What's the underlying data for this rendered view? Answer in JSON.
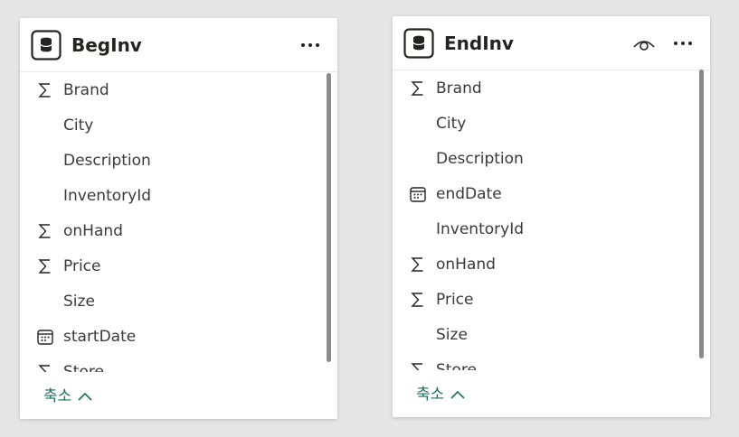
{
  "colors": {
    "background": "#e6e6e6",
    "card": "#ffffff",
    "title_text": "#252423",
    "field_text": "#3b3a39",
    "icon": "#252423",
    "collapse_link": "#1b6e5a",
    "scrollbar": "#8a8a8a"
  },
  "cards": [
    {
      "title": "BegInv",
      "header_icons": [
        "table-icon",
        "more-options-icon"
      ],
      "collapse_label": "축소",
      "fields": [
        {
          "label": "Brand",
          "icon": "sigma-icon"
        },
        {
          "label": "City",
          "icon": null
        },
        {
          "label": "Description",
          "icon": null
        },
        {
          "label": "InventoryId",
          "icon": null
        },
        {
          "label": "onHand",
          "icon": "sigma-icon"
        },
        {
          "label": "Price",
          "icon": "sigma-icon"
        },
        {
          "label": "Size",
          "icon": null
        },
        {
          "label": "startDate",
          "icon": "calendar-icon"
        },
        {
          "label": "Store",
          "icon": "sigma-icon"
        }
      ]
    },
    {
      "title": "EndInv",
      "header_icons": [
        "table-icon",
        "hidden-view-icon",
        "more-options-icon"
      ],
      "collapse_label": "축소",
      "fields": [
        {
          "label": "Brand",
          "icon": "sigma-icon"
        },
        {
          "label": "City",
          "icon": null
        },
        {
          "label": "Description",
          "icon": null
        },
        {
          "label": "endDate",
          "icon": "calendar-icon"
        },
        {
          "label": "InventoryId",
          "icon": null
        },
        {
          "label": "onHand",
          "icon": "sigma-icon"
        },
        {
          "label": "Price",
          "icon": "sigma-icon"
        },
        {
          "label": "Size",
          "icon": null
        },
        {
          "label": "Store",
          "icon": "sigma-icon"
        }
      ]
    }
  ]
}
